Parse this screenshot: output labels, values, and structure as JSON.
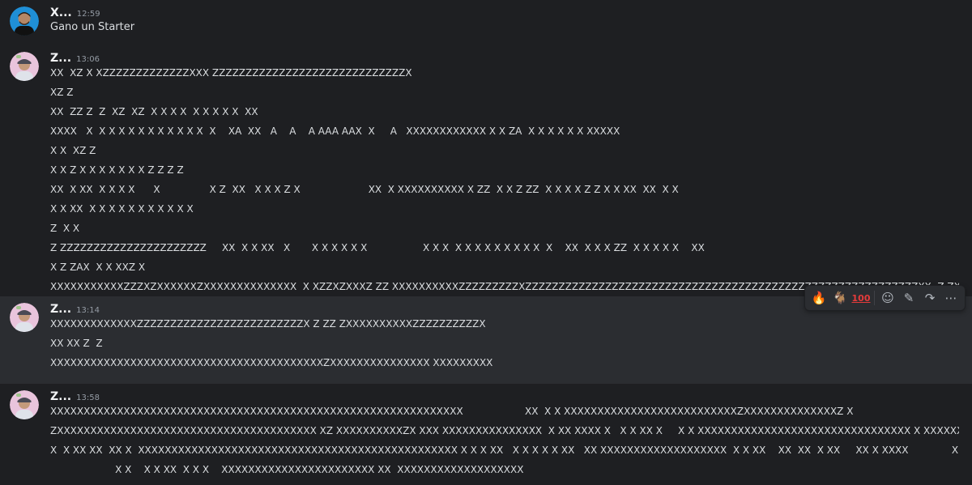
{
  "messages": [
    {
      "username": "X...",
      "time": "12:59",
      "avatar": "avatar-blue-circle-man",
      "lines": [
        "Gano un Starter"
      ]
    },
    {
      "username": "Z...",
      "time": "13:06",
      "avatar": "avatar-pink-circle-man-cap",
      "lines": [
        "XX  XZ X XZZZZZZZZZZZZZXXX ZZZZZZZZZZZZZZZZZZZZZZZZZZZZZX",
        "XZ Z",
        "XX  ZZ Z  Z  XZ  XZ  X X X X  X X X X X  XX",
        "XXXX   X  X X X X X X X X X X X  X    XA  XX   A    A    A AAA AAX  X     A   XXXXXXXXXXXX X X ZA  X X X X X X XXXXX",
        "X X  XZ Z",
        "X X Z X X X X X X X Z Z Z Z",
        "XX  X XX  X X X X      X                X Z  XX   X X X Z X                      XX  X XXXXXXXXXX X ZZ  X X Z ZZ  X X X X Z Z X X XX  XX  X X",
        "X X XX  X X X X X X X X X X X",
        "Z  X X",
        "Z ZZZZZZZZZZZZZZZZZZZZZZ     XX  X X XX   X       X X X X X X                  X X X  X X X X X X X X X  X    XX  X X X ZZ  X X X X X    XX",
        "X Z ZAX  X X XXZ X",
        "XXXXXXXXXXXZZZXZXXXXXXZXXXXXXXXXXXXXX  X XZZXZXXXZ ZZ XXXXXXXXXXZZZZZZZZZXZZZZZZZZZZZZZZZZZZZZZZZZZZZZZZZZZZZZZZZZZZZZZZZZZZZZZZZZZZZXX  Z ZXZ"
      ]
    },
    {
      "username": "Z...",
      "time": "13:14",
      "avatar": "avatar-pink-circle-man-cap",
      "lines": [
        "XXXXXXXXXXXXXZZZZZZZZZZZZZZZZZZZZZZZZZX Z ZZ ZXXXXXXXXXXZZZZZZZZZZX",
        "XX XX Z  Z",
        "XXXXXXXXXXXXXXXXXXXXXXXXXXXXXXXXXXXXXXXXXZXXXXXXXXXXXXXXX XXXXXXXXX"
      ]
    },
    {
      "username": "Z...",
      "time": "13:58",
      "avatar": "avatar-pink-circle-man-cap",
      "lines": [
        "XXXXXXXXXXXXXXXXXXXXXXXXXXXXXXXXXXXXXXXXXXXXXXXXXXXXXXXXXXXXXX                    XX  X X XXXXXXXXXXXXXXXXXXXXXXXXXXZXXXXXXXXXXXXXXZ X",
        "ZXXXXXXXXXXXXXXXXXXXXXXXXXXXXXXXXXXXXXXX XZ XXXXXXXXXXZX XXX XXXXXXXXXXXXXXX  X XX XXXX X   X X XX X     X X XXXXXXXXXXXXXXXXXXXXXXXXXXXXXXXX X XXXXXXX  XX   X",
        "X  X XX XX  XX X  XXXXXXXXXXXXXXXXXXXXXXXXXXXXXXXXXXXXXXXXXXXXXXXX X X X XX   X X X X X XX   XX XXXXXXXXXXXXXXXXXXX  X X XX    XX  XX  X XX     XX X XXXX              X XX",
        "                     X X    X X XX  X X X    XXXXXXXXXXXXXXXXXXXXXXX XX  XXXXXXXXXXXXXXXXXXX"
      ]
    }
  ],
  "toolbar": {
    "reactions": [
      "fire-emoji",
      "goat-emoji",
      "hundred-points-emoji"
    ],
    "fire": "🔥",
    "goat": "🐐",
    "hundred": "100",
    "add_reaction": "☺",
    "edit": "✎",
    "forward": "↷",
    "more": "⋯"
  },
  "colors": {
    "background": "#1e1f22",
    "hover_background": "#2b2d31",
    "text": "#dbdee1",
    "username": "#f2f3f5",
    "timestamp": "#949ba4"
  }
}
